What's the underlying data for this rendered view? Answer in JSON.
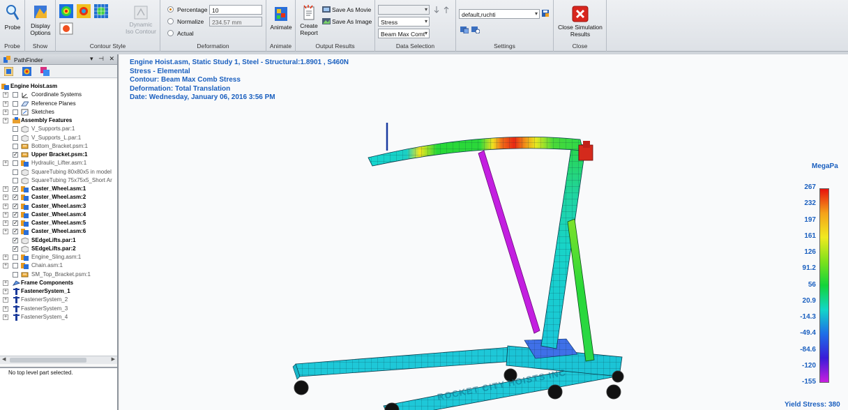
{
  "ribbon": {
    "probe": {
      "label": "Probe",
      "group": "Probe"
    },
    "show": {
      "display_options": "Display Options",
      "group": "Show"
    },
    "contour_style": {
      "dynamic_iso": "Dynamic Iso Contour",
      "group": "Contour Style"
    },
    "deformation": {
      "percentage_label": "Percentage",
      "percentage_value": "10",
      "normalize_label": "Normalize",
      "normalize_value": "234.57 mm",
      "actual_label": "Actual",
      "group": "Deformation"
    },
    "animate": {
      "label": "Animate",
      "group": "Animate"
    },
    "output": {
      "create_report": "Create Report",
      "save_movie": "Save As Movie",
      "save_image": "Save As Image",
      "group": "Output Results"
    },
    "data_selection": {
      "top_value": "",
      "type_value": "Stress",
      "component_value": "Beam Max Comt",
      "group": "Data Selection"
    },
    "settings": {
      "profile_value": "default,ruchti",
      "group": "Settings"
    },
    "close": {
      "label": "Close Simulation Results",
      "group": "Close"
    }
  },
  "pathfinder": {
    "title": "PathFinder",
    "controls": [
      "▾",
      "⊣",
      "✕"
    ],
    "tree": [
      {
        "label": "Engine Hoist.asm",
        "bold": true,
        "icon": "assembly-icon",
        "expander": "",
        "check": "none"
      },
      {
        "label": "Coordinate Systems",
        "icon": "coordinate-icon",
        "expander": "+",
        "check": "off"
      },
      {
        "label": "Reference Planes",
        "icon": "plane-icon",
        "expander": "+",
        "check": "off"
      },
      {
        "label": "Sketches",
        "icon": "sketch-icon",
        "expander": "+",
        "check": "off"
      },
      {
        "label": "Assembly Features",
        "bold": true,
        "icon": "feature-icon",
        "expander": "+",
        "check": "none"
      },
      {
        "label": "V_Supports.par:1",
        "icon": "part-icon",
        "expander": "",
        "check": "off",
        "dim": true
      },
      {
        "label": "V_Supports_L.par:1",
        "icon": "part-icon",
        "expander": "",
        "check": "off",
        "dim": true
      },
      {
        "label": "Bottom_Bracket.psm:1",
        "icon": "sheetmetal-icon",
        "expander": "",
        "check": "off",
        "dim": true
      },
      {
        "label": "Upper Bracket.psm:1",
        "bold": true,
        "icon": "sheetmetal-icon",
        "expander": "",
        "check": "on"
      },
      {
        "label": "Hydraulic_Lifter.asm:1",
        "icon": "assembly-icon",
        "expander": "+",
        "check": "off",
        "dim": true
      },
      {
        "label": "SquareTubing 80x80x5 in model",
        "icon": "part-icon",
        "expander": "",
        "check": "off",
        "dim": true
      },
      {
        "label": "SquareTubing 75x75x5_Short Ar",
        "icon": "part-icon",
        "expander": "",
        "check": "off",
        "dim": true
      },
      {
        "label": "Caster_Wheel.asm:1",
        "bold": true,
        "icon": "assembly-icon",
        "expander": "+",
        "check": "on"
      },
      {
        "label": "Caster_Wheel.asm:2",
        "bold": true,
        "icon": "assembly-icon",
        "expander": "+",
        "check": "on"
      },
      {
        "label": "Caster_Wheel.asm:3",
        "bold": true,
        "icon": "assembly-icon",
        "expander": "+",
        "check": "on"
      },
      {
        "label": "Caster_Wheel.asm:4",
        "bold": true,
        "icon": "assembly-icon",
        "expander": "+",
        "check": "on"
      },
      {
        "label": "Caster_Wheel.asm:5",
        "bold": true,
        "icon": "assembly-icon",
        "expander": "+",
        "check": "on"
      },
      {
        "label": "Caster_Wheel.asm:6",
        "bold": true,
        "icon": "assembly-icon",
        "expander": "+",
        "check": "on"
      },
      {
        "label": "SEdgeLifts.par:1",
        "bold": true,
        "icon": "part-icon",
        "expander": "",
        "check": "on"
      },
      {
        "label": "SEdgeLifts.par:2",
        "bold": true,
        "icon": "part-icon",
        "expander": "",
        "check": "on"
      },
      {
        "label": "Engine_Sling.asm:1",
        "icon": "assembly-icon",
        "expander": "+",
        "check": "off",
        "dim": true
      },
      {
        "label": "Chain.asm:1",
        "icon": "assembly-icon",
        "expander": "+",
        "check": "off",
        "dim": true
      },
      {
        "label": "SM_Top_Bracket.psm:1",
        "icon": "sheetmetal-icon",
        "expander": "",
        "check": "off",
        "dim": true
      },
      {
        "label": "Frame Components",
        "bold": true,
        "icon": "frame-icon",
        "expander": "+",
        "check": "none"
      },
      {
        "label": "FastenerSystem_1",
        "bold": true,
        "icon": "fastener-icon",
        "expander": "+",
        "check": "none"
      },
      {
        "label": "FastenerSystem_2",
        "icon": "fastener-icon",
        "expander": "+",
        "check": "none",
        "dim": true
      },
      {
        "label": "FastenerSystem_3",
        "icon": "fastener-icon",
        "expander": "+",
        "check": "none",
        "dim": true
      },
      {
        "label": "FastenerSystem_4",
        "icon": "fastener-icon",
        "expander": "+",
        "check": "none",
        "dim": true
      }
    ],
    "status": "No top level part selected."
  },
  "viewport": {
    "info_lines": [
      "Engine Hoist.asm, Static Study 1, Steel - Structural:1.8901 , S460N",
      "Stress - Elemental",
      "Contour: Beam Max Comb Stress",
      "Deformation: Total Translation",
      "Date: Wednesday, January 06, 2016  3:56 PM"
    ],
    "model_text": "ROCKET CITY HOISTS INC",
    "legend": {
      "unit": "MegaPa",
      "ticks": [
        "267",
        "232",
        "197",
        "161",
        "126",
        "91.2",
        "56",
        "20.9",
        "-14.3",
        "-49.4",
        "-84.6",
        "-120",
        "-155"
      ],
      "colors": [
        "#e8120c",
        "#f4a21a",
        "#f0ea20",
        "#7ee21c",
        "#12d43a",
        "#12d6c8",
        "#1e6ee8",
        "#3a1cd8",
        "#c81ee0"
      ],
      "yield": "Yield Stress: 380"
    }
  }
}
